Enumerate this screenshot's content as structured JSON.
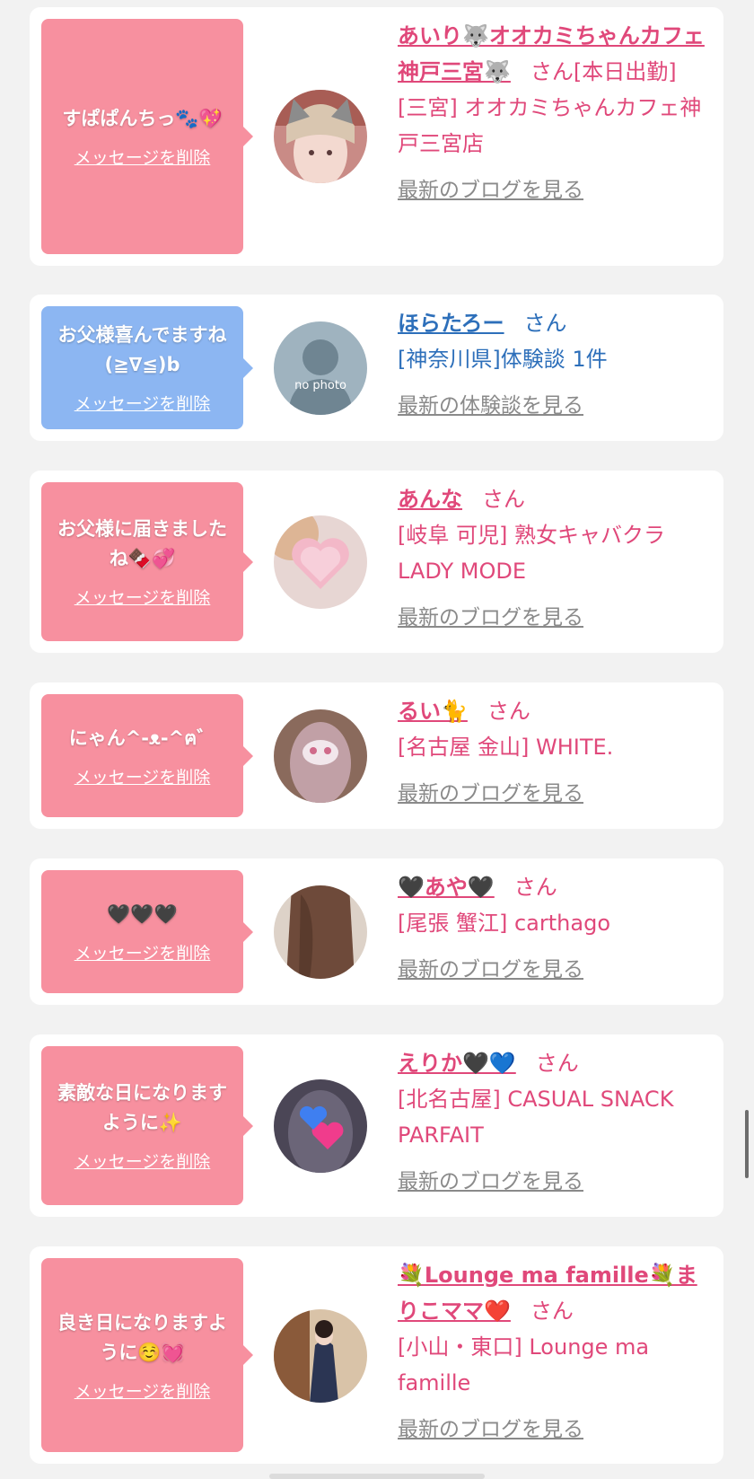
{
  "messages": [
    {
      "message": "すぱぱんちっ🐾💖",
      "delete_label": "メッセージを削除",
      "name": "あいり🐺オオカミちゃんカフェ神戸三宮🐺",
      "suffix": "さん[本日出勤]",
      "shop": "[三宮] オオカミちゃんカフェ神戸三宮店",
      "link": "最新のブログを見る"
    },
    {
      "message": "お父様喜んでますね(≧∇≦)b",
      "delete_label": "メッセージを削除",
      "name": "ほらたろー",
      "suffix": "さん",
      "shop": "[神奈川県]体験談 1件",
      "link": "最新の体験談を見る",
      "avatar_text": "no photo"
    },
    {
      "message": "お父様に届きましたね🍫💞",
      "delete_label": "メッセージを削除",
      "name": "あんな",
      "suffix": "さん",
      "shop": "[岐阜 可児] 熟女キャバクラ LADY MODE",
      "link": "最新のブログを見る"
    },
    {
      "message": "にゃん^-ᴥ-^ฅ゛",
      "delete_label": "メッセージを削除",
      "name": "るい🐈",
      "suffix": "さん",
      "shop": "[名古屋 金山] WHITE.",
      "link": "最新のブログを見る"
    },
    {
      "message": "🖤🖤🖤",
      "delete_label": "メッセージを削除",
      "name": "🖤あや🖤",
      "suffix": "さん",
      "shop": "[尾張 蟹江] carthago",
      "link": "最新のブログを見る"
    },
    {
      "message": "素敵な日になりますように✨",
      "delete_label": "メッセージを削除",
      "name": "えりか🖤💙",
      "suffix": "さん",
      "shop": "[北名古屋] CASUAL SNACK PARFAIT",
      "link": "最新のブログを見る"
    },
    {
      "message": "良き日になりますように☺️💓",
      "delete_label": "メッセージを削除",
      "name": "💐Lounge ma famille💐まりこママ❤️",
      "suffix": "さん",
      "shop": "[小山・東口] Lounge ma famille",
      "link": "最新のブログを見る"
    }
  ]
}
